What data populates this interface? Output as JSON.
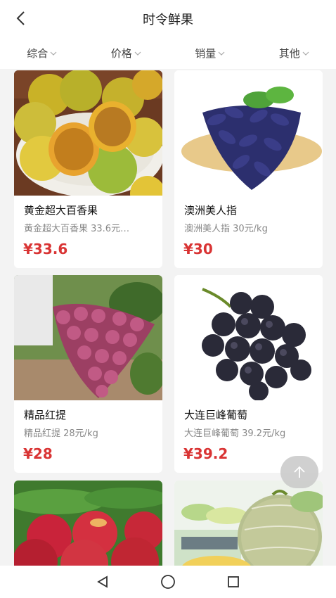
{
  "header": {
    "title": "时令鲜果",
    "back_icon": "chevron-left-icon"
  },
  "filters": [
    {
      "label": "综合",
      "icon": "chevron-down-icon"
    },
    {
      "label": "价格",
      "icon": "chevron-down-icon"
    },
    {
      "label": "销量",
      "icon": "chevron-down-icon"
    },
    {
      "label": "其他",
      "icon": "chevron-down-icon"
    }
  ],
  "products": [
    {
      "name": "黄金超大百香果",
      "desc": "黄金超大百香果 33.6元…",
      "price": "¥33.6",
      "image": "passion-fruit"
    },
    {
      "name": "澳洲美人指",
      "desc": "澳洲美人指 30元/kg",
      "price": "¥30",
      "image": "finger-grapes"
    },
    {
      "name": "精品红提",
      "desc": "精品红提 28元/kg",
      "price": "¥28",
      "image": "red-grapes"
    },
    {
      "name": "大连巨峰葡萄",
      "desc": "大连巨峰葡萄 39.2元/kg",
      "price": "¥39.2",
      "image": "kyoho-grapes"
    },
    {
      "name": "",
      "desc": "",
      "price": "",
      "image": "nectarines"
    },
    {
      "name": "",
      "desc": "",
      "price": "",
      "image": "melon"
    }
  ],
  "scroll_top": {
    "icon": "arrow-up-icon"
  },
  "system_nav": {
    "back": "triangle-back-icon",
    "home": "circle-home-icon",
    "recents": "square-recents-icon"
  },
  "colors": {
    "price": "#d93434",
    "background": "#f3f3f3",
    "card": "#ffffff"
  }
}
